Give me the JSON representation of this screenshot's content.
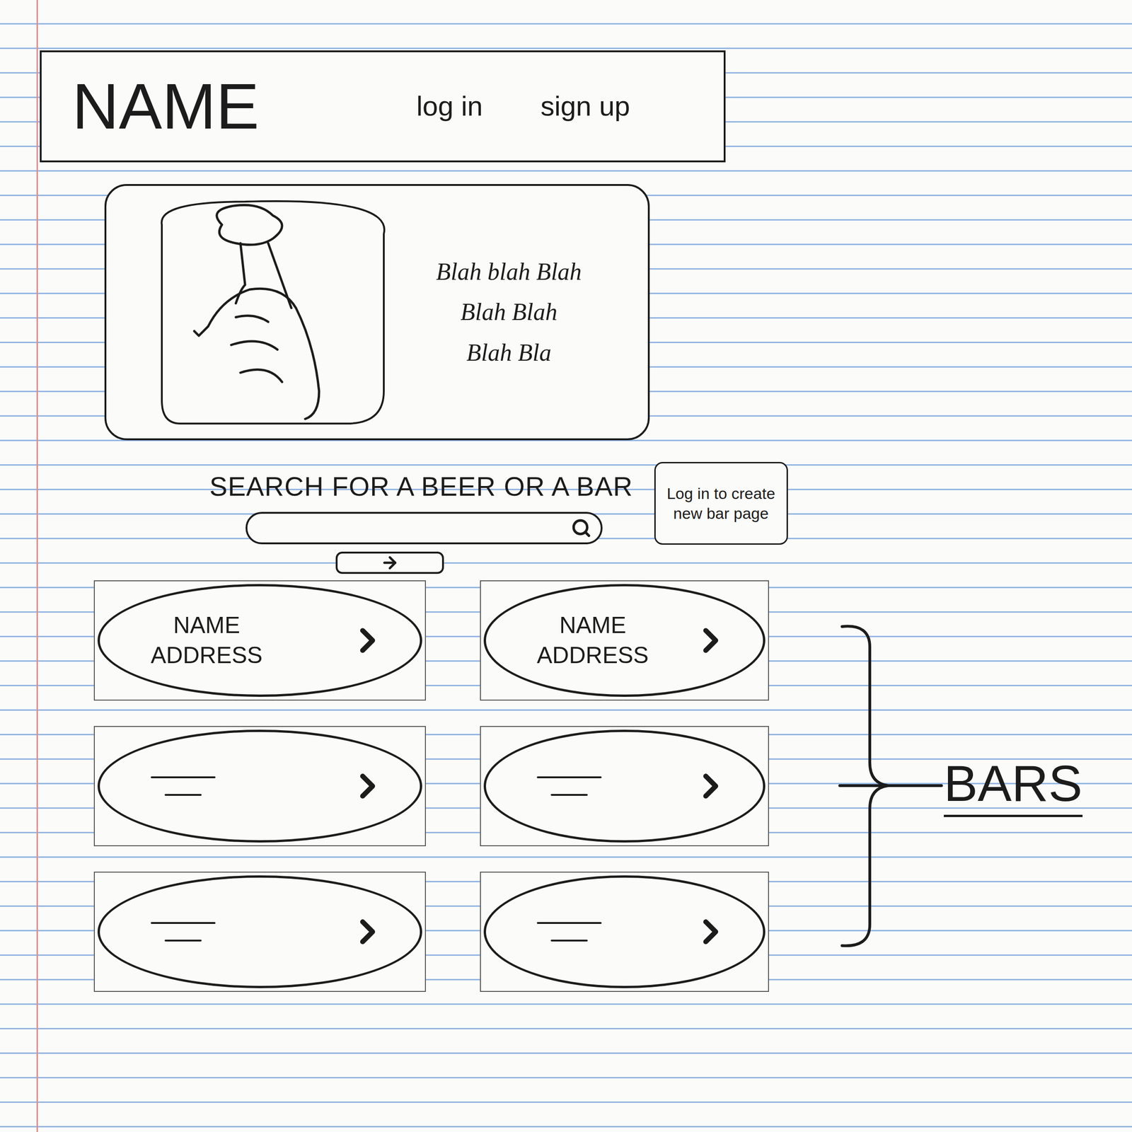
{
  "header": {
    "title": "NAME",
    "links": [
      "log in",
      "sign up"
    ]
  },
  "hero": {
    "lines": [
      "Blah blah Blah",
      "Blah Blah",
      "Blah Bla"
    ]
  },
  "search": {
    "label": "SEARCH FOR A BEER OR A BAR",
    "note": "Log in to create new bar page"
  },
  "bars": {
    "label": "BARS",
    "items": [
      {
        "kind": "filled",
        "name": "NAME",
        "address": "ADDRESS"
      },
      {
        "kind": "filled",
        "name": "NAME",
        "address": "ADDRESS"
      },
      {
        "kind": "empty"
      },
      {
        "kind": "empty"
      },
      {
        "kind": "empty"
      },
      {
        "kind": "empty"
      }
    ]
  }
}
